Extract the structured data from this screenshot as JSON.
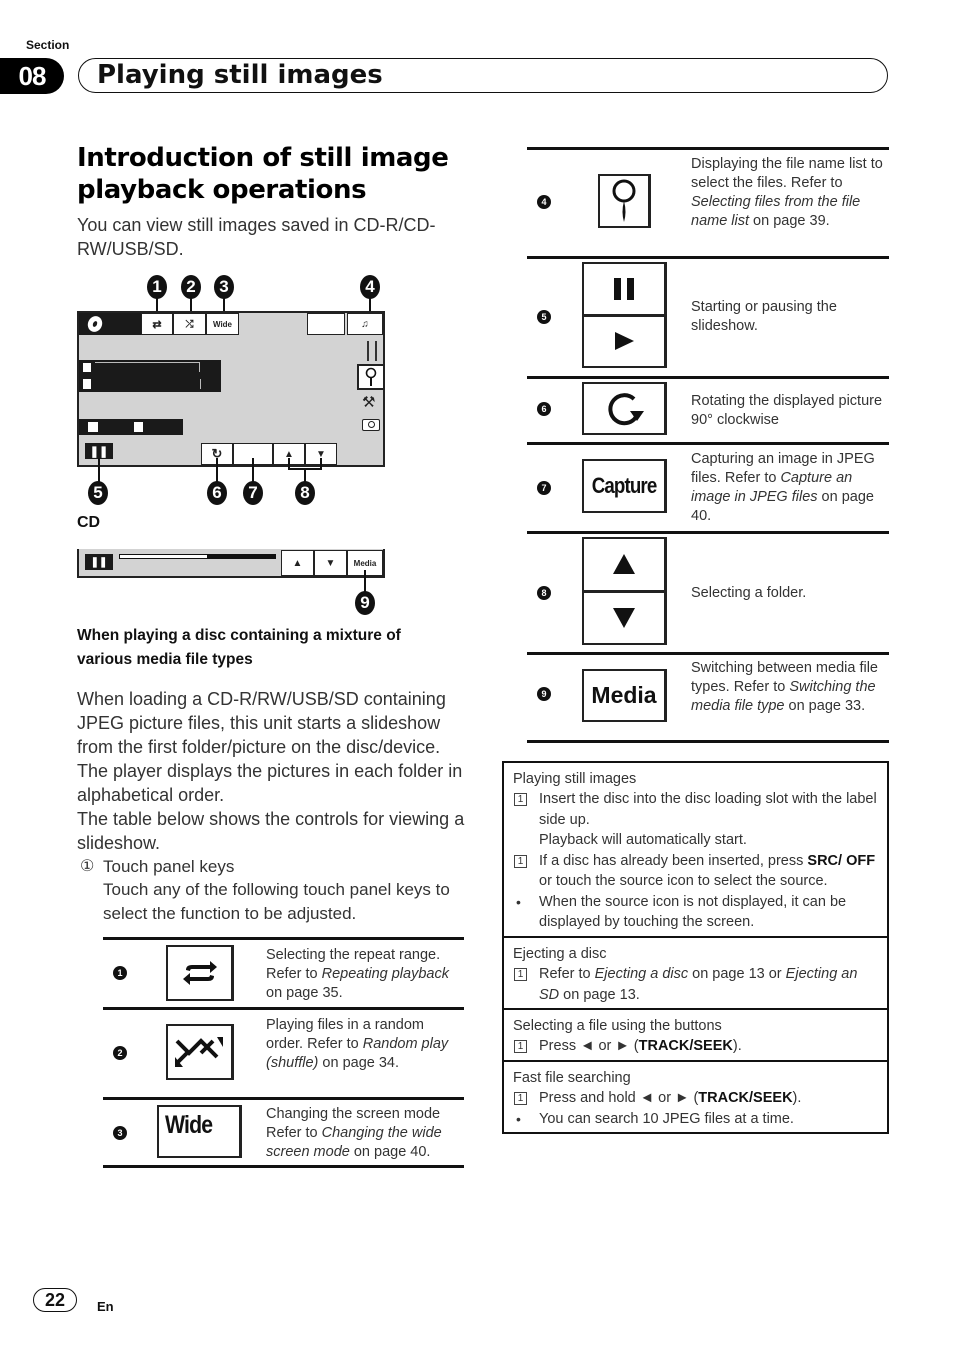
{
  "header": {
    "section_label": "Section",
    "section_number": "08",
    "section_title": "Playing still images"
  },
  "main": {
    "title": "Introduction of still image playback operations",
    "intro": "You can view still images saved in CD-R/CD-RW/USB/SD.",
    "diagram": {
      "callouts": [
        "1",
        "2",
        "3",
        "4",
        "5",
        "6",
        "7",
        "8",
        "9"
      ],
      "wide_label": "Wide",
      "media_label": "Media",
      "cd_label": "CD",
      "progress_fraction": 0.57
    },
    "subheading": "When playing a disc containing a mixture of various media file types",
    "paragraphs": [
      "When loading a CD-R/RW/USB/SD containing JPEG picture files, this unit starts a slideshow from the first folder/picture on the disc/device.",
      "The player displays the pictures in each folder in alphabetical order.",
      "The table below shows the controls for viewing a slideshow."
    ],
    "touch_keys": {
      "marker": "①",
      "label": "Touch panel keys",
      "text": "Touch any of the following touch panel keys to select the function to be adjusted."
    }
  },
  "keys_table": [
    {
      "num": "1",
      "icon": "repeat-icon",
      "desc_pre": "Selecting the repeat range. Refer to ",
      "desc_ref": "Repeating playback",
      "desc_post": " on page 35."
    },
    {
      "num": "2",
      "icon": "shuffle-icon",
      "desc_pre": "Playing files in a random order. Refer to ",
      "desc_ref": "Random play (shuffle)",
      "desc_post": " on page 34."
    },
    {
      "num": "3",
      "icon": "wide-key",
      "key_label": "Wide",
      "desc_pre": "Changing the screen mode Refer to ",
      "desc_ref": "Changing the wide screen mode",
      "desc_post": " on page 40."
    },
    {
      "num": "4",
      "icon": "search-icon",
      "desc_pre": "Displaying the file name list to select the files. Refer to ",
      "desc_ref": "Selecting files from the file name list",
      "desc_post": " on page 39."
    },
    {
      "num": "5",
      "icon": "pause-play-icon",
      "desc_pre": "Starting or pausing the slideshow.",
      "desc_ref": "",
      "desc_post": ""
    },
    {
      "num": "6",
      "icon": "rotate-icon",
      "desc_pre": "Rotating the displayed picture 90° clockwise",
      "desc_ref": "",
      "desc_post": ""
    },
    {
      "num": "7",
      "icon": "capture-key",
      "key_label": "Capture",
      "desc_pre": "Capturing an image in JPEG files. Refer to ",
      "desc_ref": "Capture an image in JPEG files",
      "desc_post": " on page 40."
    },
    {
      "num": "8",
      "icon": "folder-up-down-icon",
      "desc_pre": "Selecting a folder.",
      "desc_ref": "",
      "desc_post": ""
    },
    {
      "num": "9",
      "icon": "media-key",
      "key_label": "Media",
      "desc_pre": "Switching between media file types. Refer to ",
      "desc_ref": "Switching the media file type",
      "desc_post": " on page 33."
    }
  ],
  "info_box": [
    {
      "title": "Playing still images",
      "steps": [
        {
          "type": "step",
          "marker": "1",
          "html": "Insert the disc into the disc loading slot with the label side up.<br>Playback will automatically start."
        },
        {
          "type": "step",
          "marker": "1",
          "html": "If a disc has already been inserted, press <b>SRC/ OFF</b> or touch the source icon to select the source."
        },
        {
          "type": "bullet",
          "marker": "•",
          "html": "When the source icon is not displayed, it can be displayed by touching the screen."
        }
      ]
    },
    {
      "title": "Ejecting a disc",
      "steps": [
        {
          "type": "step",
          "marker": "1",
          "html": "Refer to <i>Ejecting a disc</i> on page 13 or <i>Ejecting an SD</i> on page 13."
        }
      ]
    },
    {
      "title": "Selecting a file using the buttons",
      "steps": [
        {
          "type": "step",
          "marker": "1",
          "html": "Press ◄ or ► (<b>TRACK/SEEK</b>)."
        }
      ]
    },
    {
      "title": "Fast file searching",
      "steps": [
        {
          "type": "step",
          "marker": "1",
          "html": "Press and hold ◄ or ► (<b>TRACK/SEEK</b>)."
        },
        {
          "type": "bullet",
          "marker": "•",
          "html": "You can search 10 JPEG files at a time."
        }
      ]
    }
  ],
  "footer": {
    "page_number": "22",
    "language": "En"
  }
}
